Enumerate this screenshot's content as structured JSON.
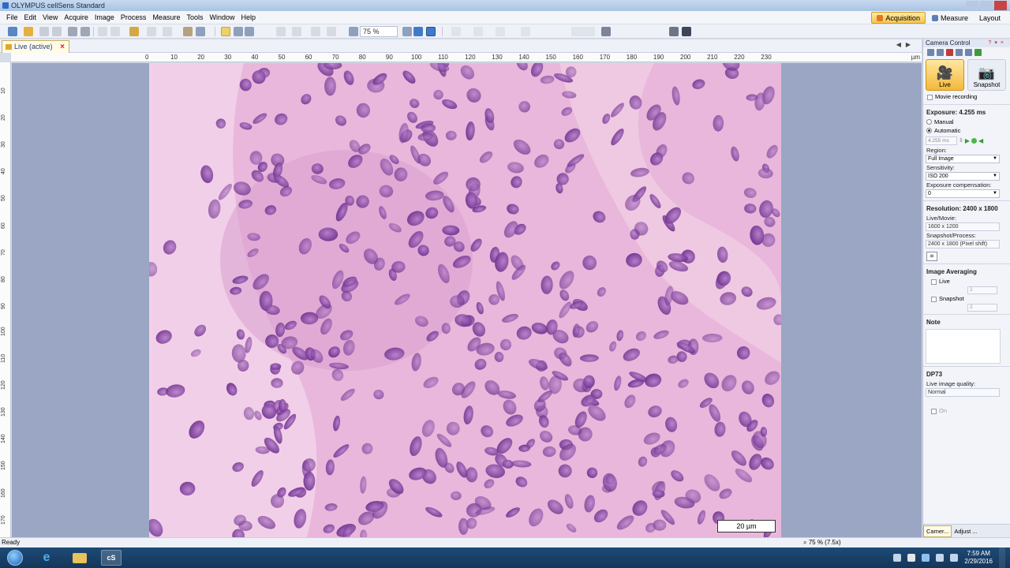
{
  "window": {
    "title": "OLYMPUS cellSens Standard"
  },
  "menu": [
    "File",
    "Edit",
    "View",
    "Acquire",
    "Image",
    "Process",
    "Measure",
    "Tools",
    "Window",
    "Help"
  ],
  "layout_tabs": {
    "acquisition": "Acquisition",
    "measure": "Measure",
    "layout": "Layout"
  },
  "toolbar": {
    "zoom_value": "75 %"
  },
  "document": {
    "tab_label": "Live (active)"
  },
  "ruler": {
    "h_labels": [
      "0",
      "10",
      "20",
      "30",
      "40",
      "50",
      "60",
      "70",
      "80",
      "90",
      "100",
      "110",
      "120",
      "130",
      "140",
      "150",
      "160",
      "170",
      "180",
      "190",
      "200",
      "210",
      "220",
      "230"
    ],
    "unit": "µm",
    "v_labels": [
      "10",
      "20",
      "30",
      "40",
      "50",
      "60",
      "70",
      "80",
      "90",
      "100",
      "110",
      "120",
      "130",
      "140",
      "150",
      "160",
      "170"
    ]
  },
  "image": {
    "scalebar_label": "20 µm"
  },
  "status": {
    "left_text": "Ready",
    "zoom_text": "75 % (7.5x)"
  },
  "camera_control": {
    "title": "Camera Control",
    "live_label": "Live",
    "snapshot_label": "Snapshot",
    "movie_recording": "Movie recording",
    "exposure_heading": "Exposure: 4.255 ms",
    "manual": "Manual",
    "automatic": "Automatic",
    "exposure_value": "4.255 ms",
    "region_label": "Region:",
    "region_value": "Full Image",
    "sensitivity_label": "Sensitivity:",
    "sensitivity_value": "ISO 200",
    "exposure_comp_label": "Exposure compensation:",
    "exposure_comp_value": "0",
    "resolution_heading": "Resolution: 2400 x 1800",
    "live_movie_label": "Live/Movie:",
    "live_movie_value": "1600 x 1200",
    "snapshot_process_label": "Snapshot/Process:",
    "snapshot_process_value": "2400 x 1800 (Pixel shift)",
    "image_averaging_heading": "Image Averaging",
    "avg_live": "Live",
    "avg_snapshot": "Snapshot",
    "avg_live_frames": "2",
    "avg_snapshot_frames": "2",
    "note_heading": "Note",
    "camera_model": "DP73",
    "live_quality_label": "Live image quality:",
    "live_quality_value": "Normal",
    "on_label": "On",
    "bottom_tab_camera": "Camer...",
    "bottom_tab_adjust": "Adjust ..."
  },
  "taskbar": {
    "time": "7:59 AM",
    "date": "2/29/2016"
  },
  "colors": {
    "accent": "#f3b93a",
    "canvas_bg": "#9aa6c3",
    "taskbar": "#1d4a76",
    "tissue_pink": "#e6b4d8",
    "nuclei_purple": "#7a3d9a"
  },
  "icons": [
    "search-icon",
    "camera-icon",
    "live-camera-icon",
    "close-icon",
    "windows-start-icon",
    "ie-icon",
    "folder-icon",
    "cellsens-icon"
  ]
}
